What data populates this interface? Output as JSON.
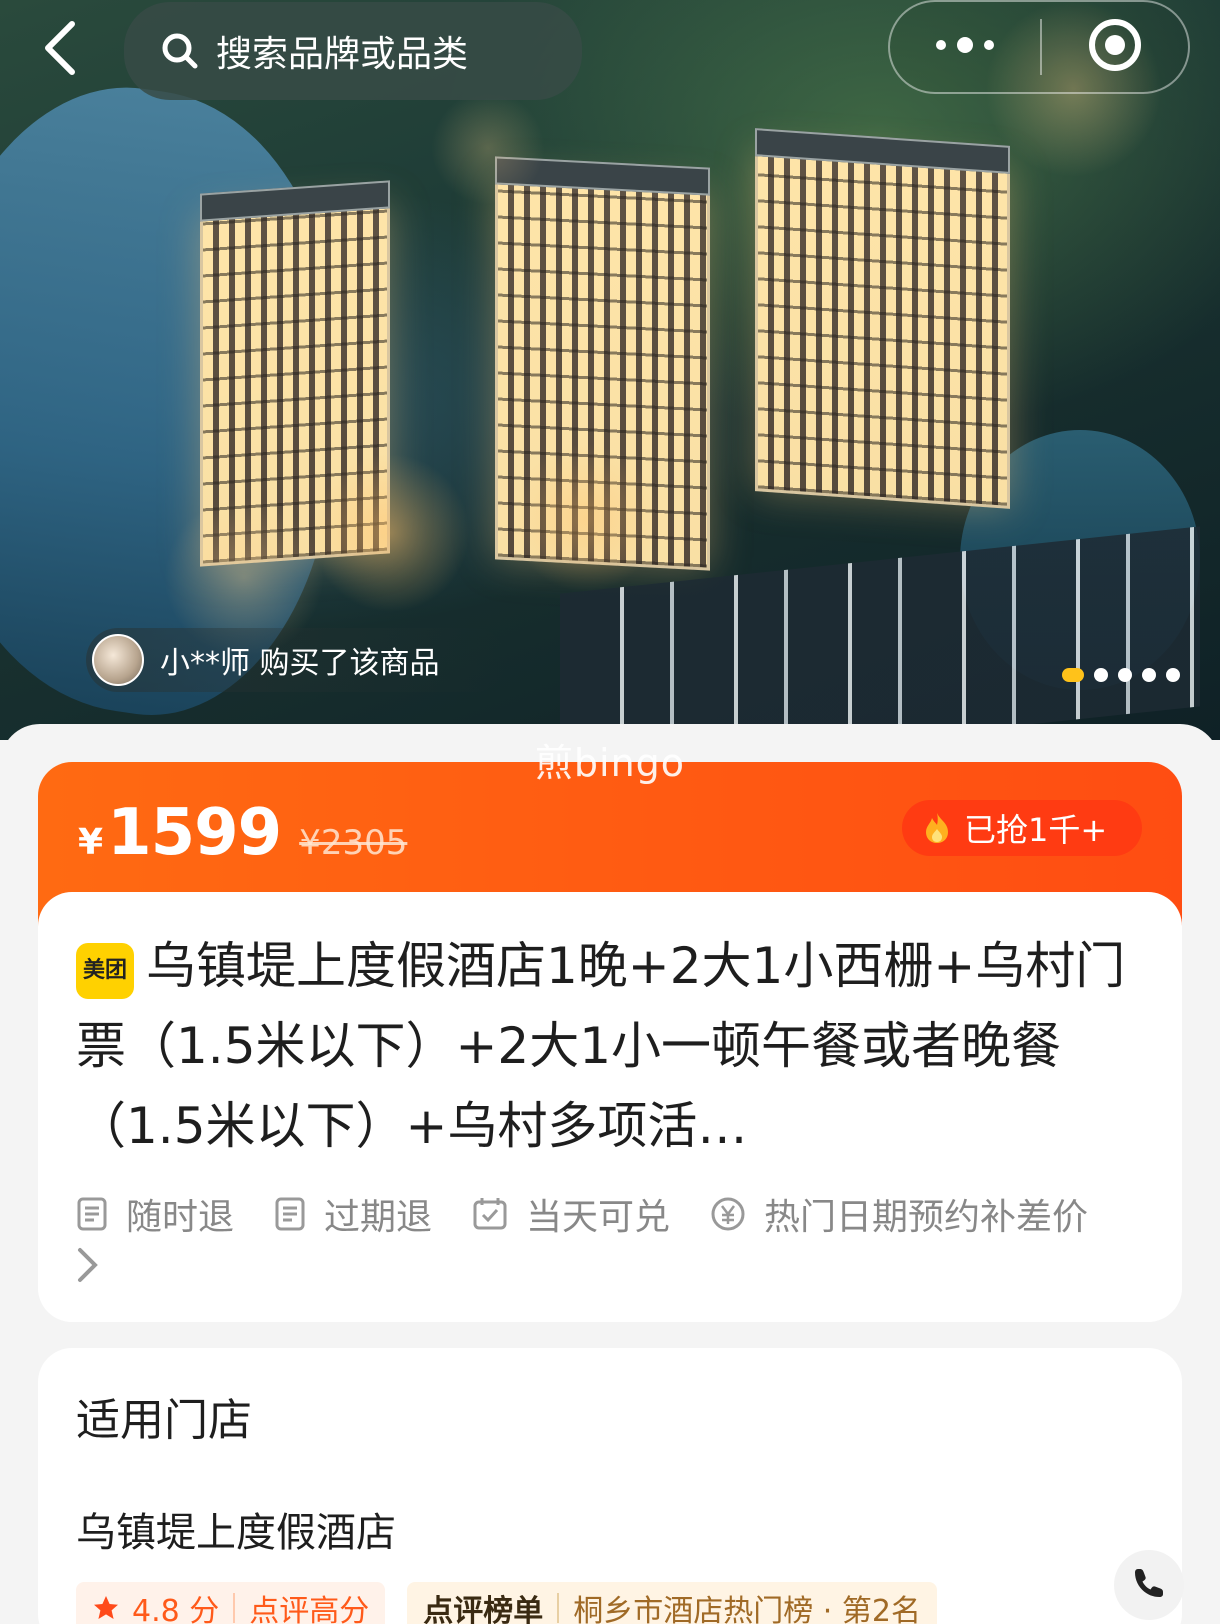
{
  "header": {
    "search_placeholder": "搜索品牌或品类",
    "more_icon": "more-dots-icon",
    "close_icon": "target-circle-icon"
  },
  "hero": {
    "buyer_text": "小**师 购买了该商品",
    "carousel_total": 5,
    "carousel_active": 1,
    "watermark": "煎bingo"
  },
  "price": {
    "currency": "¥",
    "current": "1599",
    "original": "¥2305",
    "sold": "已抢1千+"
  },
  "product": {
    "brand_badge": "美团",
    "title": "乌镇堤上度假酒店1晚+2大1小西栅+乌村门票（1.5米以下）+2大1小一顿午餐或者晚餐（1.5米以下）+乌村多项活…",
    "tags": [
      "随时退",
      "过期退",
      "当天可兑",
      "热门日期预约补差价"
    ]
  },
  "store": {
    "section_title": "适用门店",
    "name": "乌镇堤上度假酒店",
    "rating": "4.8 分",
    "rating_label": "点评高分",
    "rank_label": "点评榜单",
    "rank_text": "桐乡市酒店热门榜 · 第2名"
  },
  "colors": {
    "accent": "#ff5a12",
    "accent_deep": "#ff3b12",
    "carousel_active": "#ffc21a",
    "brand_yellow": "#ffd100"
  }
}
